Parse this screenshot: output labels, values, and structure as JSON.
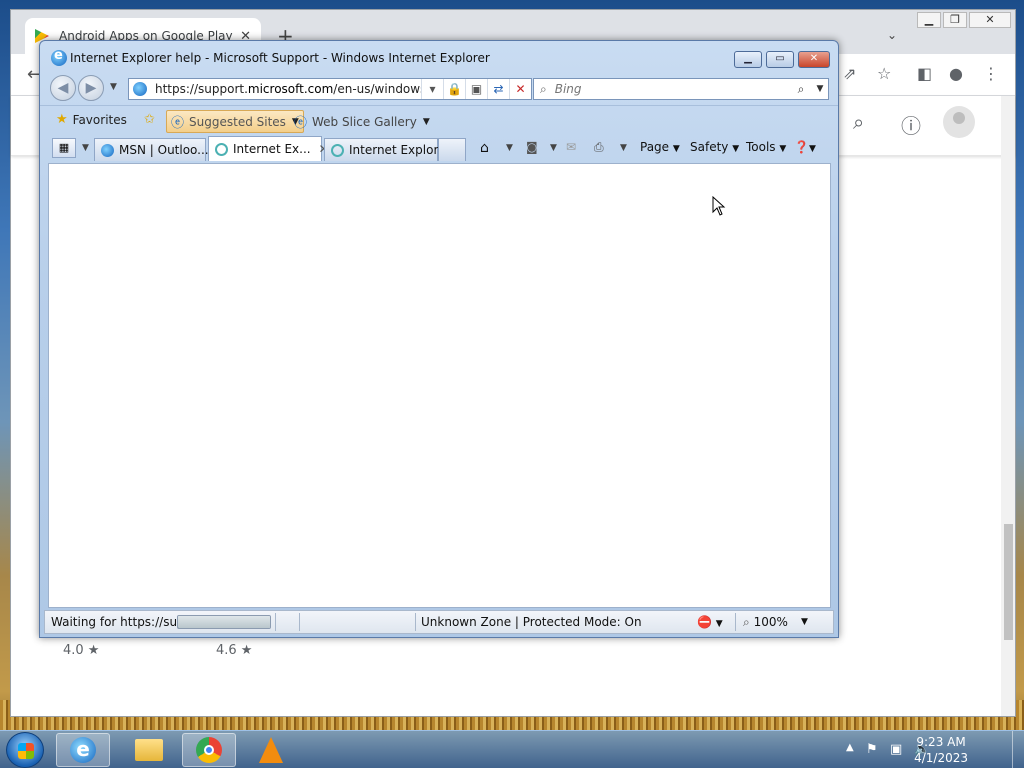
{
  "chrome": {
    "tab_title": "Android Apps on Google Play",
    "tab_close": "✕",
    "new_tab": "+",
    "ratings": [
      "4.0 ★",
      "4.6 ★"
    ]
  },
  "ie": {
    "window_title": "Internet Explorer help - Microsoft Support - Windows Internet Explorer",
    "address": {
      "prefix": "https://support.",
      "domain": "microsoft.com",
      "suffix": "/en-us/windows"
    },
    "search_placeholder": "Bing",
    "favorites": {
      "favorites_label": "Favorites",
      "suggested_sites": "Suggested Sites",
      "web_slice_gallery": "Web Slice Gallery"
    },
    "tabs": [
      {
        "label": "MSN | Outloo..."
      },
      {
        "label": "Internet Ex..."
      },
      {
        "label": "Internet Explor..."
      }
    ],
    "commands": {
      "page": "Page",
      "safety": "Safety",
      "tools": "Tools"
    },
    "status": {
      "text": "Waiting for https://sup",
      "progress": 1.0,
      "zone": "Unknown Zone | Protected Mode: On",
      "zoom": "100%"
    }
  },
  "taskbar": {
    "time": "9:23 AM",
    "date": "4/1/2023"
  }
}
